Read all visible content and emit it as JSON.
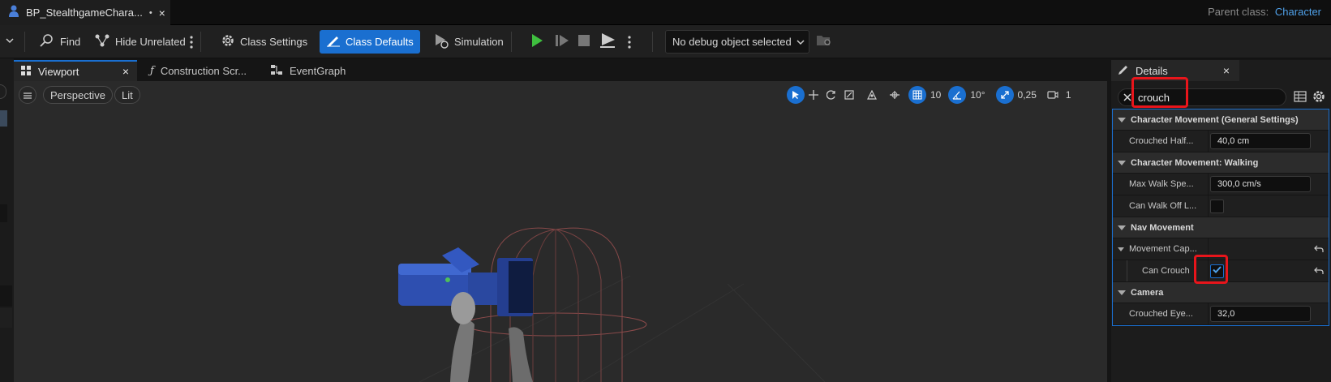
{
  "window": {
    "doc_tab_title": "BP_StealthgameChara...",
    "modified_marker": "•",
    "close_glyph": "×",
    "parent_class_label": "Parent class:",
    "parent_class_value": "Character"
  },
  "toolbar": {
    "find_label": "Find",
    "hide_unrelated_label": "Hide Unrelated",
    "class_settings_label": "Class Settings",
    "class_defaults_label": "Class Defaults",
    "simulation_label": "Simulation",
    "debug_object": "No debug object selected"
  },
  "tabs": {
    "viewport": "Viewport",
    "construction_script": "Construction Scr...",
    "event_graph": "EventGraph",
    "close_glyph": "×"
  },
  "viewport": {
    "perspective_label": "Perspective",
    "lit_label": "Lit",
    "grid_snap": "10",
    "rotation_snap": "10°",
    "scale_snap": "0,25",
    "camera_speed": "1"
  },
  "details": {
    "tab_label": "Details",
    "close_glyph": "×",
    "search_value": "crouch",
    "categories": [
      {
        "title": "Character Movement (General Settings)",
        "rows": [
          {
            "name": "Crouched Half...",
            "value": "40,0 cm"
          }
        ]
      },
      {
        "title": "Character Movement: Walking",
        "rows": [
          {
            "name": "Max Walk Spe...",
            "value": "300,0 cm/s"
          },
          {
            "name": "Can Walk Off L...",
            "checked": false
          }
        ]
      },
      {
        "title": "Nav Movement",
        "rows": [
          {
            "name": "Movement Cap..."
          },
          {
            "name": "Can Crouch",
            "checked": true
          }
        ]
      },
      {
        "title": "Camera",
        "rows": [
          {
            "name": "Crouched Eye...",
            "value": "32,0"
          }
        ]
      }
    ]
  },
  "colors": {
    "accent": "#1a6fd0",
    "highlight": "#e8151b",
    "play_green": "#3fbf3f",
    "parent_class_link": "#4fa0e8"
  }
}
